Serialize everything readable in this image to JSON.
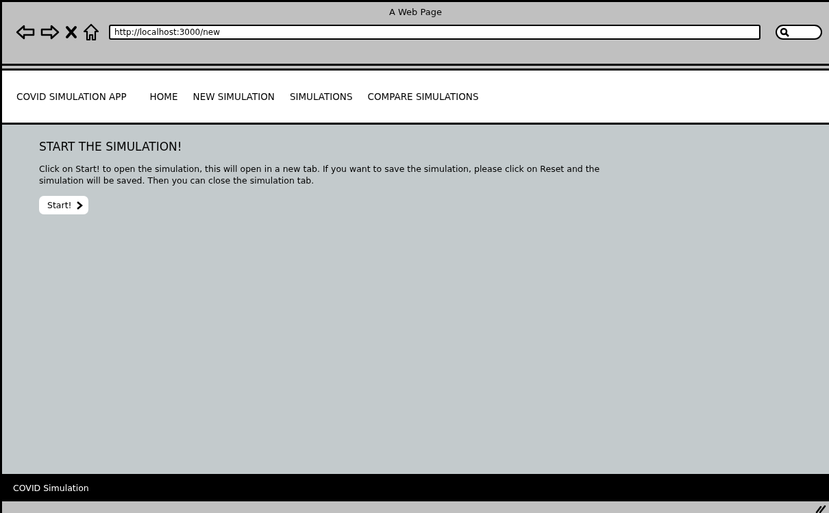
{
  "window": {
    "title": "A Web Page",
    "address": "http://localhost:3000/new"
  },
  "navbar": {
    "brand": "COVID SIMULATION APP",
    "links": [
      "HOME",
      "NEW SIMULATION",
      "SIMULATIONS",
      "COMPARE SIMULATIONS"
    ]
  },
  "content": {
    "heading": "START THE SIMULATION!",
    "paragraph": "Click on Start! to open the simulation, this will open in a new tab. If you want to save the simulation, please click on Reset and the simulation will be saved. Then you can close the simulation tab.",
    "button": "Start!"
  },
  "footer": {
    "text": "COVID Simulation"
  }
}
